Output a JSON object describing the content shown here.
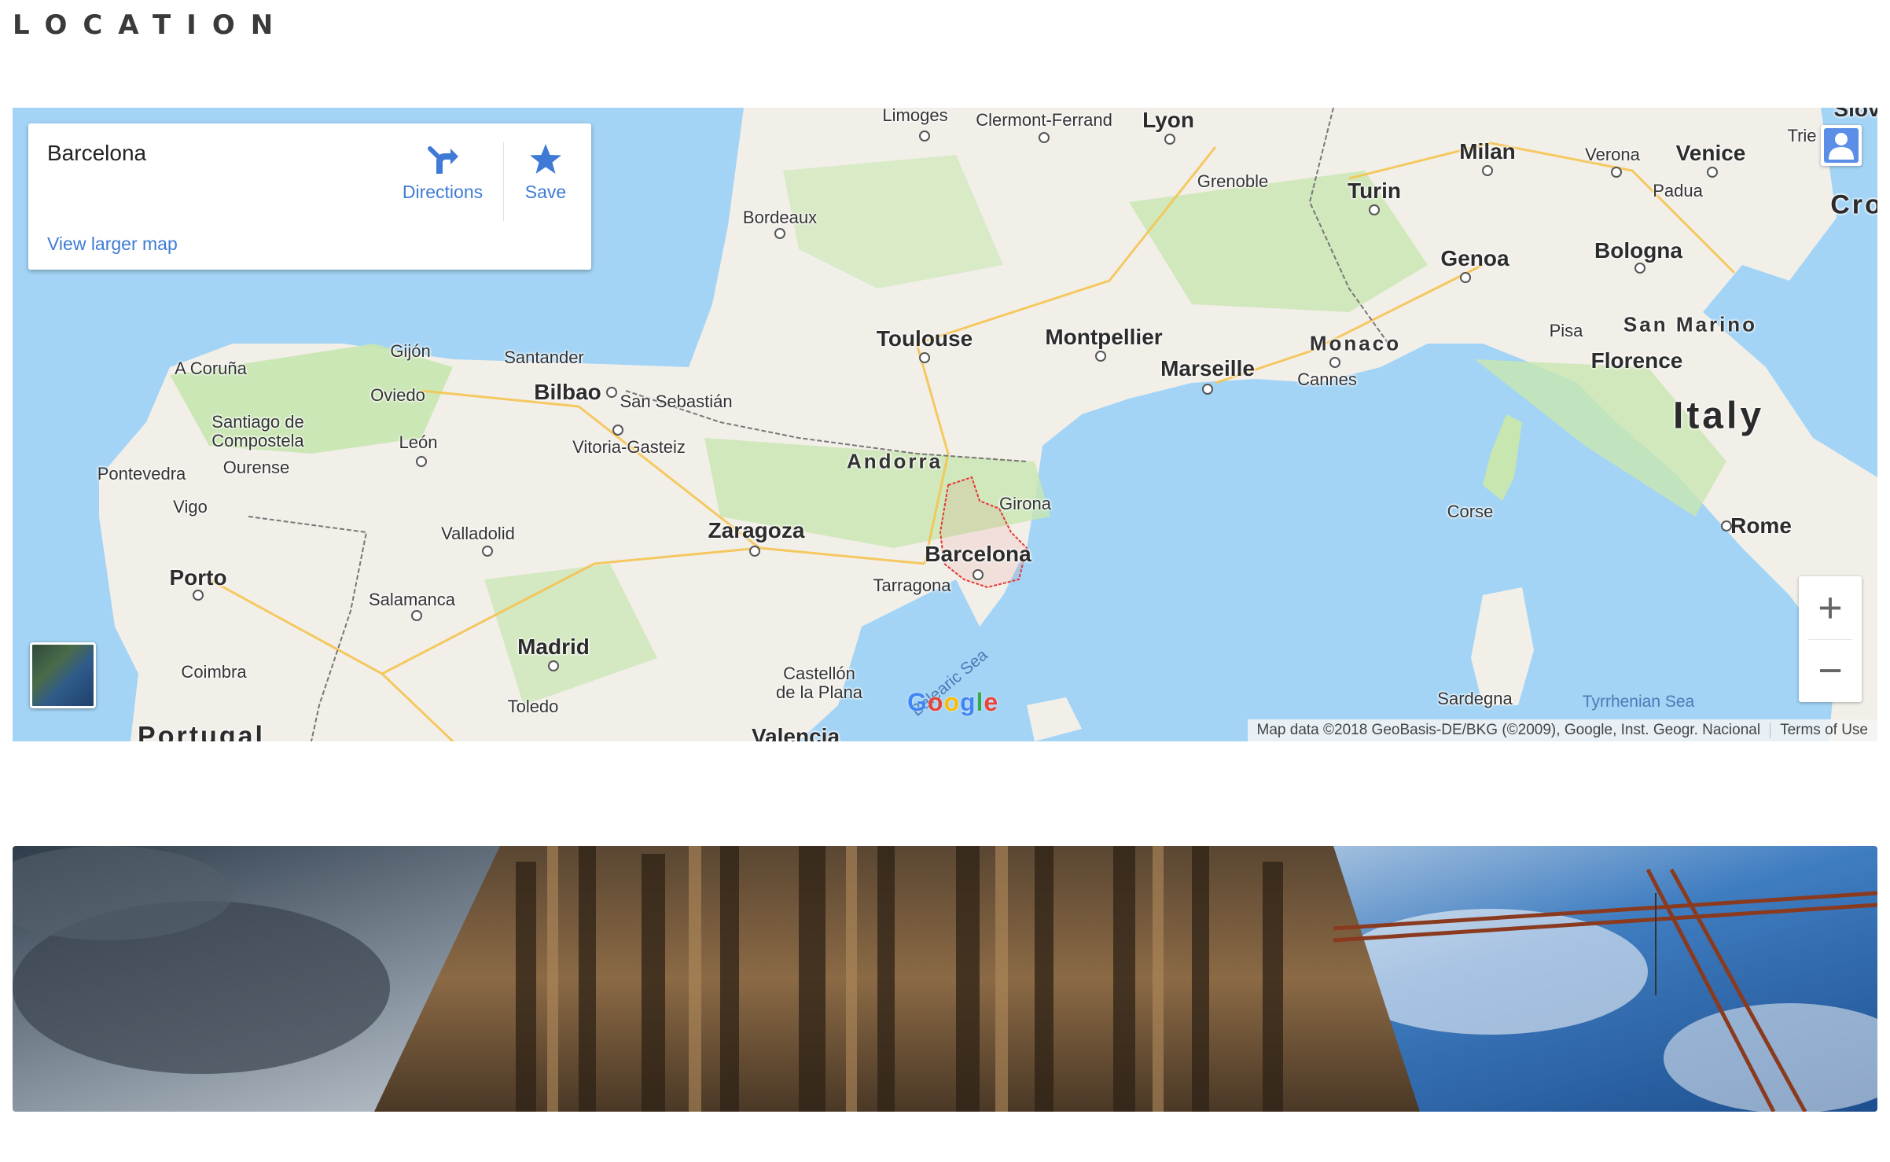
{
  "section": {
    "title": "LOCATION"
  },
  "map": {
    "info_card": {
      "place_name": "Barcelona",
      "directions_label": "Directions",
      "save_label": "Save",
      "larger_map_link": "View larger map"
    },
    "zoom": {
      "in_label": "+",
      "out_label": "−"
    },
    "logo_text": "Google",
    "attribution": {
      "data_text": "Map data ©2018 GeoBasis-DE/BKG (©2009), Google, Inst. Geogr. Nacional",
      "terms_text": "Terms of Use"
    },
    "labels": {
      "limoges": "Limoges",
      "clermont": "Clermont-Ferrand",
      "lyon": "Lyon",
      "milan": "Milan",
      "verona": "Verona",
      "venice": "Venice",
      "trieste": "Trie",
      "slovenia": "Slov",
      "croatia": "Cro",
      "padua": "Padua",
      "grenoble": "Grenoble",
      "turin": "Turin",
      "bordeaux": "Bordeaux",
      "genoa": "Genoa",
      "bologna": "Bologna",
      "toulouse": "Toulouse",
      "montpellier": "Montpellier",
      "monaco": "Monaco",
      "pisa": "Pisa",
      "san_marino": "San Marino",
      "marseille": "Marseille",
      "cannes": "Cannes",
      "florence": "Florence",
      "a_coruna": "A Coruña",
      "gijon": "Gijón",
      "santander": "Santander",
      "bilbao": "Bilbao",
      "san_sebastian": "San Sebastián",
      "oviedo": "Oviedo",
      "santiago": "Santiago de\nCompostela",
      "leon": "León",
      "vitoria": "Vitoria-Gasteiz",
      "italy": "Italy",
      "andorra": "Andorra",
      "ourense": "Ourense",
      "pontevedra": "Pontevedra",
      "girona": "Girona",
      "corse": "Corse",
      "vigo": "Vigo",
      "valladolid": "Valladolid",
      "zaragoza": "Zaragoza",
      "rome": "Rome",
      "barcelona": "Barcelona",
      "porto": "Porto",
      "tarragona": "Tarragona",
      "salamanca": "Salamanca",
      "madrid": "Madrid",
      "coimbra": "Coimbra",
      "castellon": "Castellón\nde la Plana",
      "balearic_sea": "Balearic Sea",
      "toledo": "Toledo",
      "sardegna": "Sardegna",
      "tyrrhenian": "Tyrrhenian Sea",
      "portugal": "Portugal",
      "valencia": "Valencia"
    }
  },
  "colors": {
    "link": "#3f7bd6",
    "water": "#a3d4f5",
    "land": "#f2efe9",
    "park": "#c8e6b0",
    "border_highlight": "#e53935"
  },
  "photo": {
    "subject": "Sagrada Família facade with construction crane"
  }
}
